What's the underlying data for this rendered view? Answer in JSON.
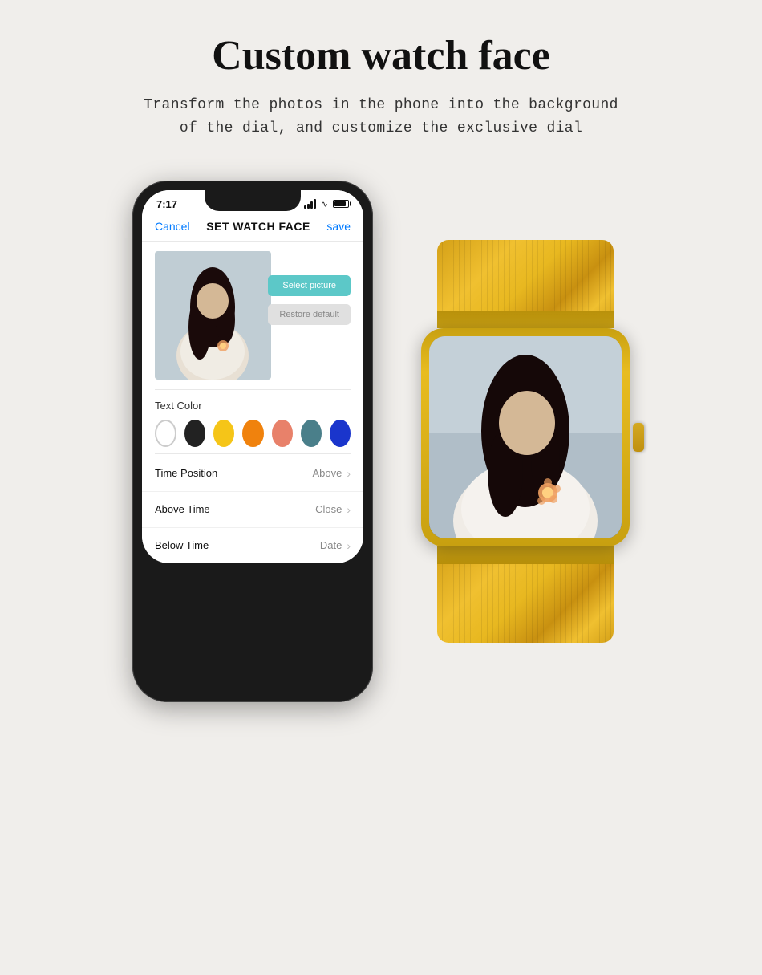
{
  "page": {
    "title": "Custom watch face",
    "subtitle_line1": "Transform the photos in the phone into the background",
    "subtitle_line2": "of the dial, and customize the exclusive dial"
  },
  "phone": {
    "status_time": "7:17",
    "app_cancel": "Cancel",
    "app_title": "SET WATCH FACE",
    "app_save": "save",
    "select_btn": "Select picture",
    "restore_btn": "Restore default",
    "text_color_label": "Text Color",
    "colors": [
      "white",
      "black",
      "yellow",
      "orange",
      "peach",
      "teal",
      "blue"
    ],
    "settings": [
      {
        "label": "Time Position",
        "value": "Above"
      },
      {
        "label": "Above Time",
        "value": "Close"
      },
      {
        "label": "Below Time",
        "value": "Date"
      }
    ]
  },
  "icons": {
    "chevron": "›",
    "wifi": "▾",
    "signal": "signal"
  }
}
